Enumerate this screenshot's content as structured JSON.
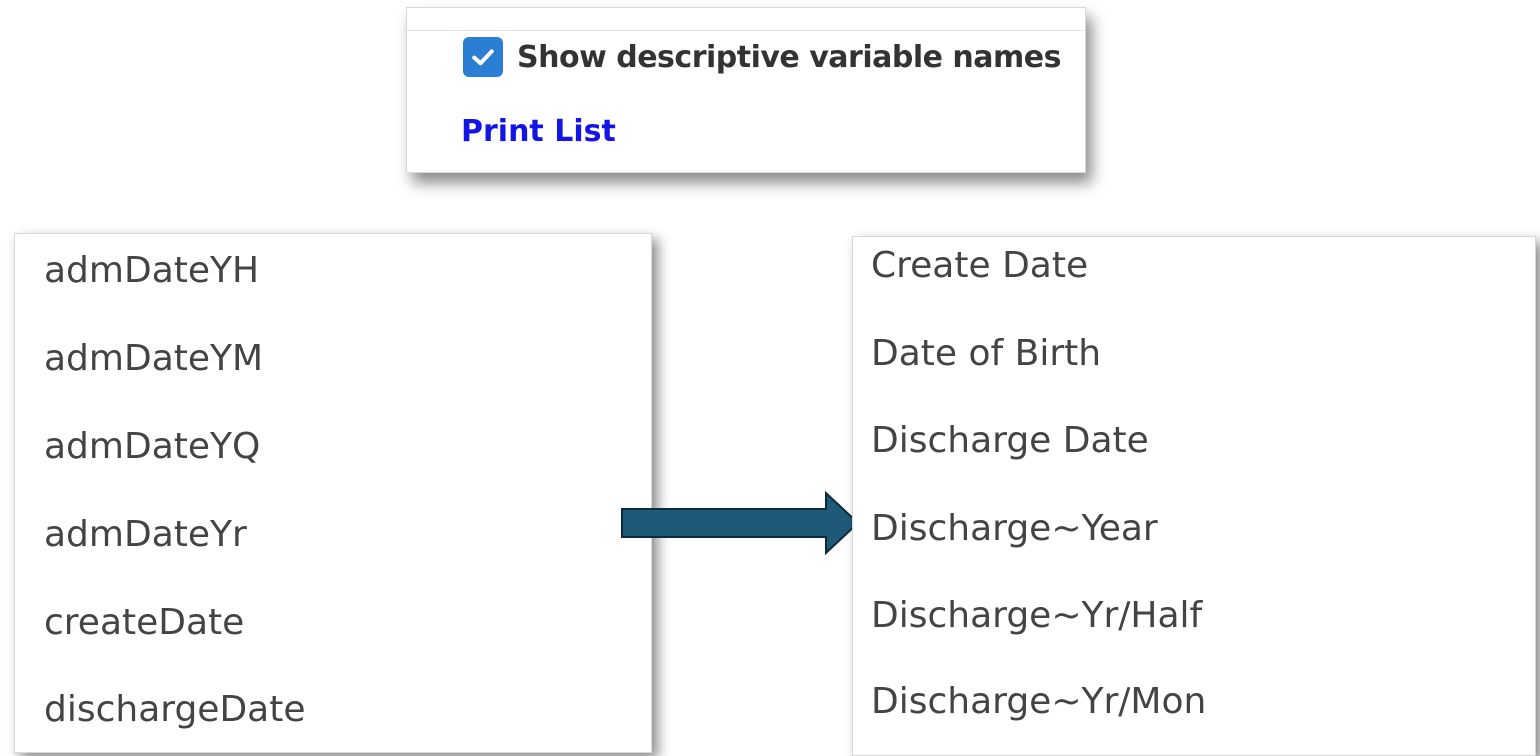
{
  "options_panel": {
    "show_descriptive_label": "Show descriptive variable names",
    "show_descriptive_checked": true,
    "print_list_label": "Print List"
  },
  "variable_list_raw": {
    "items": [
      "admDateYH",
      "admDateYM",
      "admDateYQ",
      "admDateYr",
      "createDate",
      "dischargeDate"
    ]
  },
  "variable_list_descriptive": {
    "items": [
      "Create Date",
      "Date of Birth",
      "Discharge Date",
      "Discharge~Year",
      "Discharge~Yr/Half",
      "Discharge~Yr/Mon"
    ]
  },
  "colors": {
    "checkbox": "#2a7fd4",
    "link": "#1414e6",
    "arrow": "#1e5a78"
  },
  "icons": {
    "checkbox": "checkmark-icon",
    "arrow": "right-arrow-icon"
  }
}
